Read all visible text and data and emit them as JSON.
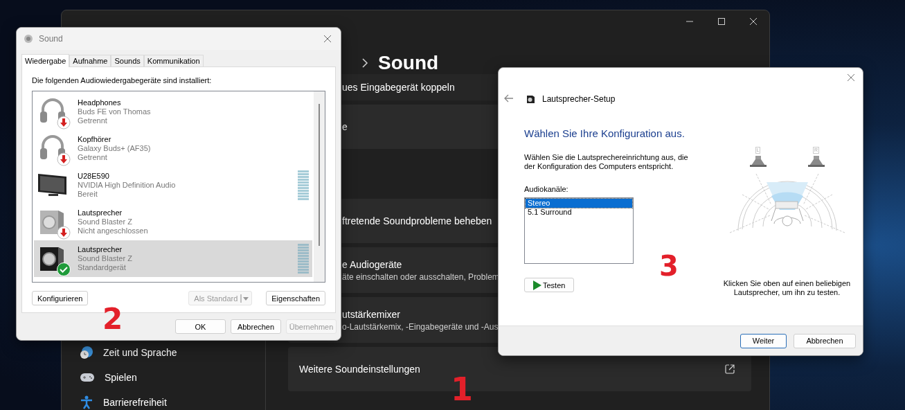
{
  "settings_window": {
    "heading": "Sound",
    "annotation": "1",
    "cards": [
      {
        "kind": "row",
        "title": "ues Eingabegerät koppeln"
      },
      {
        "kind": "row",
        "title": "e"
      },
      {
        "kind": "section"
      },
      {
        "kind": "row",
        "title": "ftretende Soundprobleme beheben"
      },
      {
        "kind": "row",
        "title": "e Audiogeräte",
        "subtitle": "äte einschalten oder ausschalten, Problem"
      },
      {
        "kind": "row",
        "title": "utstärkemixer",
        "subtitle": "o-Lautstärkemix, -Eingabegeräte und -Aus"
      },
      {
        "kind": "link",
        "title": "Weitere Soundeinstellungen"
      }
    ],
    "nav": [
      {
        "label": "Zeit und Sprache"
      },
      {
        "label": "Spielen"
      },
      {
        "label": "Barrierefreiheit"
      }
    ]
  },
  "sound_dialog": {
    "title": "Sound",
    "annotation": "2",
    "tabs": [
      {
        "label": "Wiedergabe",
        "selected": true
      },
      {
        "label": "Aufnahme",
        "selected": false
      },
      {
        "label": "Sounds",
        "selected": false
      },
      {
        "label": "Kommunikation",
        "selected": false
      }
    ],
    "intro": "Die folgenden Audiowiedergabegeräte sind installiert:",
    "devices": [
      {
        "name": "Headphones",
        "detail": "Buds FE von Thomas",
        "status": "Getrennt",
        "disconnected": true,
        "default": false,
        "meter": false,
        "selected": false
      },
      {
        "name": "Kopfhörer",
        "detail": "Galaxy Buds+ (AF35)",
        "status": "Getrennt",
        "disconnected": true,
        "default": false,
        "meter": false,
        "selected": false
      },
      {
        "name": "U28E590",
        "detail": "NVIDIA High Definition Audio",
        "status": "Bereit",
        "disconnected": false,
        "default": false,
        "meter": true,
        "selected": false
      },
      {
        "name": "Lautsprecher",
        "detail": "Sound Blaster Z",
        "status": "Nicht angeschlossen",
        "disconnected": true,
        "default": false,
        "meter": false,
        "selected": false
      },
      {
        "name": "Lautsprecher",
        "detail": "Sound Blaster Z",
        "status": "Standardgerät",
        "disconnected": false,
        "default": true,
        "meter": true,
        "selected": true
      }
    ],
    "buttons": [
      {
        "label": "Konfigurieren",
        "kind": "plain",
        "disabled": false
      },
      {
        "label": "Als Standard",
        "kind": "split",
        "disabled": true
      },
      {
        "label": "Eigenschaften",
        "kind": "plain",
        "disabled": false
      }
    ],
    "footer_buttons": [
      {
        "label": "OK",
        "disabled": false
      },
      {
        "label": "Abbrechen",
        "disabled": false
      },
      {
        "label": "Übernehmen",
        "disabled": true
      }
    ]
  },
  "setup_dialog": {
    "title": "Lautsprecher-Setup",
    "annotation": "3",
    "heading": "Wählen Sie Ihre Konfiguration aus.",
    "description": "Wählen Sie die Lautsprechereinrichtung aus, die der Konfiguration des Computers entspricht.",
    "channels_label": "Audiokanäle:",
    "channels": [
      {
        "label": "Stereo",
        "selected": true
      },
      {
        "label": "5.1 Surround",
        "selected": false
      }
    ],
    "test_button": "Testen",
    "speaker_labels": [
      "L",
      "R"
    ],
    "hint": "Klicken Sie oben auf einen beliebigen Lautsprecher, um ihn zu testen.",
    "buttons": [
      {
        "label": "Weiter",
        "default": true
      },
      {
        "label": "Abbrechen",
        "default": false
      }
    ]
  }
}
